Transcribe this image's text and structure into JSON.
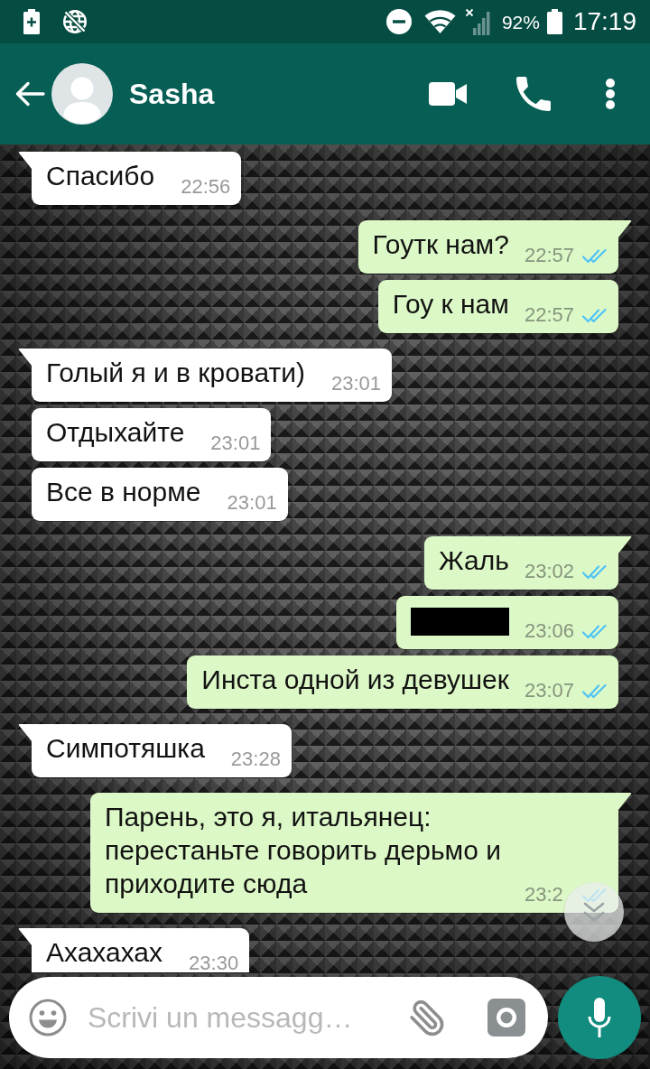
{
  "status_bar": {
    "battery_percent": "92%",
    "time": "17:19"
  },
  "header": {
    "contact_name": "Sasha"
  },
  "messages": [
    {
      "kind": "incoming",
      "redacted": false,
      "text": "Спасибо",
      "time": "22:56"
    },
    {
      "kind": "outgoing",
      "redacted": false,
      "text": "Гоутк нам?",
      "time": "22:57",
      "read": true
    },
    {
      "kind": "outgoing",
      "redacted": false,
      "text": "Гоу к нам",
      "time": "22:57",
      "read": true
    },
    {
      "kind": "incoming",
      "redacted": false,
      "text": "Голый я и в кровати)",
      "time": "23:01"
    },
    {
      "kind": "incoming",
      "redacted": false,
      "text": "Отдыхайте",
      "time": "23:01"
    },
    {
      "kind": "incoming",
      "redacted": false,
      "text": "Все в норме",
      "time": "23:01"
    },
    {
      "kind": "outgoing",
      "redacted": false,
      "text": "Жаль",
      "time": "23:02",
      "read": true
    },
    {
      "kind": "outgoing",
      "redacted": true,
      "time": "23:06",
      "read": true
    },
    {
      "kind": "outgoing",
      "redacted": false,
      "text": "Инста одной из девушек",
      "time": "23:07",
      "read": true
    },
    {
      "kind": "incoming",
      "redacted": false,
      "text": "Симпотяшка",
      "time": "23:28"
    },
    {
      "kind": "outgoing",
      "redacted": false,
      "text": "Парень, это я, итальянец: перестаньте говорить дерьмо и приходите сюда",
      "time": "23:2",
      "read": true
    },
    {
      "kind": "incoming",
      "redacted": false,
      "text": "Ахахахах",
      "time": "23:30"
    }
  ],
  "composer": {
    "placeholder": "Scrivi un messagg…"
  }
}
